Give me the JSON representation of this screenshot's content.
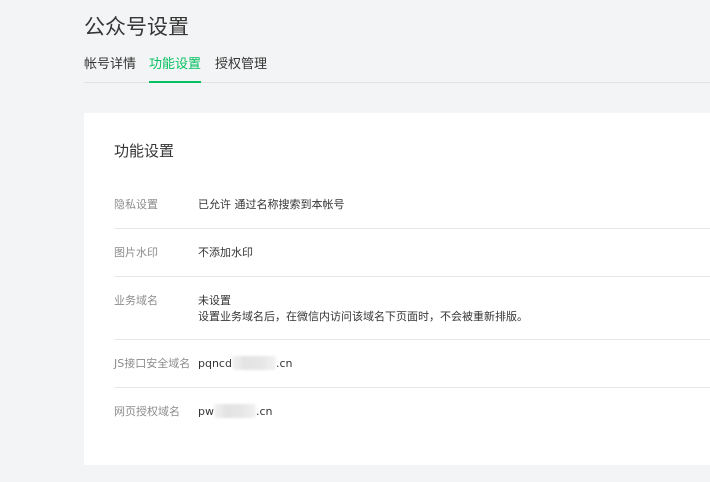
{
  "page": {
    "title": "公众号设置"
  },
  "tabs": [
    {
      "label": "帐号详情",
      "active": false
    },
    {
      "label": "功能设置",
      "active": true
    },
    {
      "label": "授权管理",
      "active": false
    }
  ],
  "card": {
    "title": "功能设置",
    "rows": [
      {
        "label": "隐私设置",
        "value": "已允许 通过名称搜索到本帐号"
      },
      {
        "label": "图片水印",
        "value": "不添加水印"
      },
      {
        "label": "业务域名",
        "value": "未设置",
        "description": "设置业务域名后，在微信内访问该域名下页面时，不会被重新排版。"
      },
      {
        "label": "JS接口安全域名",
        "value_prefix": "pqncd",
        "value_suffix": ".cn"
      },
      {
        "label": "网页授权域名",
        "value_prefix": "pw",
        "value_suffix": ".cn"
      }
    ]
  },
  "colors": {
    "accent": "#07c160",
    "background": "#f3f4f5",
    "label": "#8c8c8c"
  }
}
